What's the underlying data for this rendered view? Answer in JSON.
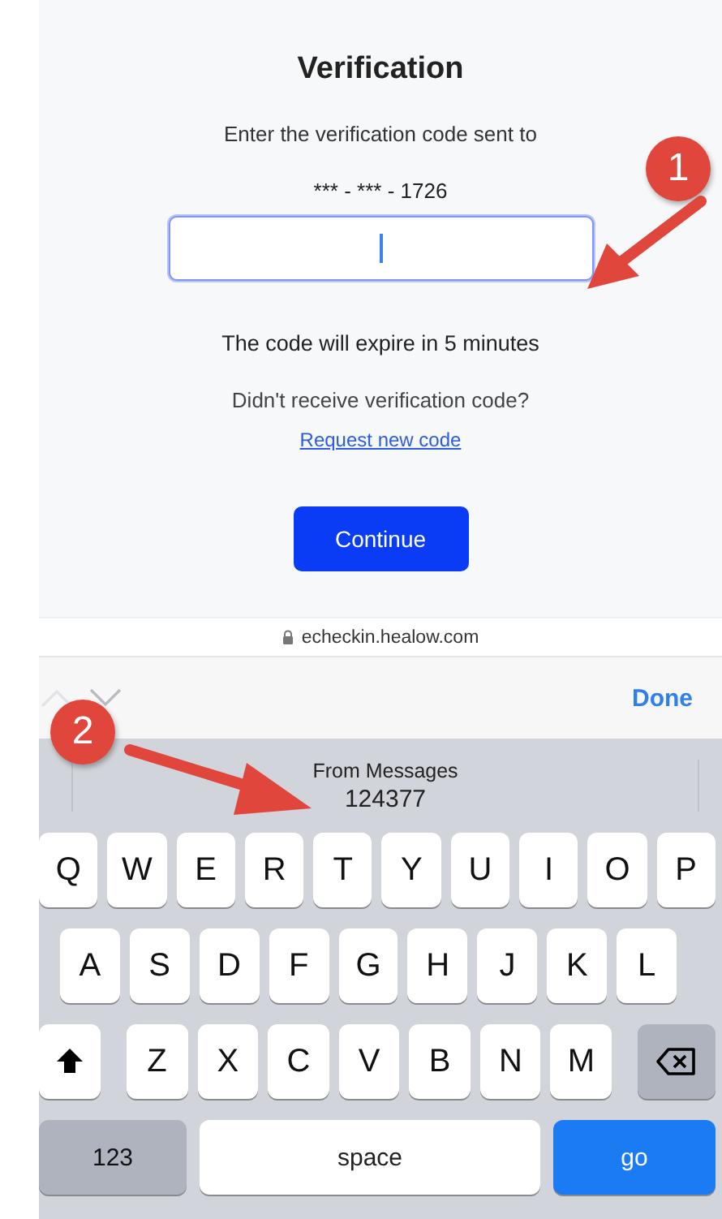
{
  "page": {
    "title": "Verification",
    "instruction": "Enter the verification code sent to",
    "phone": "*** - *** - 1726",
    "code_field": {
      "focused": true
    },
    "expiry_note": "The code will expire in 5 minutes",
    "resend_prompt": "Didn't receive verification code?",
    "resend_link": "Request new code",
    "continue_button": "Continue"
  },
  "address_bar": {
    "secure": true,
    "url": "echeckin.healow.com"
  },
  "form_toolbar": {
    "nav": [
      {
        "kind": "up",
        "disabled": true
      },
      {
        "kind": "down",
        "disabled": false
      }
    ],
    "done": "Done"
  },
  "suggestion": {
    "source": "From Messages",
    "code": "124377"
  },
  "keyboard": {
    "letter_rows": [
      [
        {
          "kind": "letter",
          "label": "Q"
        },
        {
          "kind": "letter",
          "label": "W"
        },
        {
          "kind": "letter",
          "label": "E"
        },
        {
          "kind": "letter",
          "label": "R"
        },
        {
          "kind": "letter",
          "label": "T"
        },
        {
          "kind": "letter",
          "label": "Y"
        },
        {
          "kind": "letter",
          "label": "U"
        },
        {
          "kind": "letter",
          "label": "I"
        },
        {
          "kind": "letter",
          "label": "O"
        },
        {
          "kind": "letter",
          "label": "P"
        }
      ],
      [
        {
          "kind": "letter",
          "label": "A"
        },
        {
          "kind": "letter",
          "label": "S"
        },
        {
          "kind": "letter",
          "label": "D"
        },
        {
          "kind": "letter",
          "label": "F"
        },
        {
          "kind": "letter",
          "label": "G"
        },
        {
          "kind": "letter",
          "label": "H"
        },
        {
          "kind": "letter",
          "label": "J"
        },
        {
          "kind": "letter",
          "label": "K"
        },
        {
          "kind": "letter",
          "label": "L"
        }
      ],
      [
        {
          "kind": "shift"
        },
        {
          "kind": "letter",
          "label": "Z"
        },
        {
          "kind": "letter",
          "label": "X"
        },
        {
          "kind": "letter",
          "label": "C"
        },
        {
          "kind": "letter",
          "label": "V"
        },
        {
          "kind": "letter",
          "label": "B"
        },
        {
          "kind": "letter",
          "label": "N"
        },
        {
          "kind": "letter",
          "label": "M"
        },
        {
          "kind": "backspace"
        }
      ]
    ],
    "bottom_keys": {
      "numbers": "123",
      "space": "space",
      "go": "go"
    }
  },
  "annotations": [
    {
      "label": "1"
    },
    {
      "label": "2"
    }
  ]
}
